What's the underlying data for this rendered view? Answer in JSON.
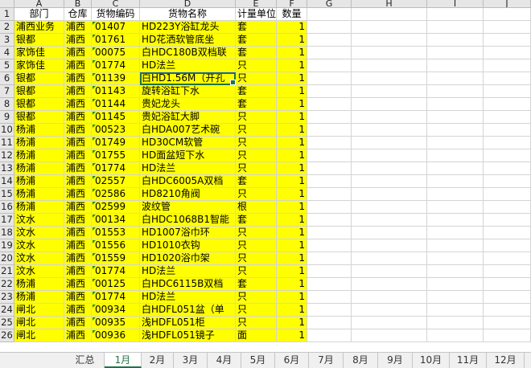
{
  "columns": [
    "A",
    "B",
    "C",
    "D",
    "E",
    "F",
    "G",
    "H",
    "I",
    "J"
  ],
  "header_row": [
    "部门",
    "仓库",
    "货物编码",
    "货物名称",
    "计量单位",
    "数量"
  ],
  "rows": [
    {
      "n": "2",
      "a": "浦西业务",
      "b": "浦西",
      "c": "01407",
      "d": "HD223Y浴缸龙头",
      "e": "套",
      "f": "1"
    },
    {
      "n": "3",
      "a": "银都",
      "b": "浦西",
      "c": "01761",
      "d": "HD花洒软管底坐",
      "e": "套",
      "f": "1"
    },
    {
      "n": "4",
      "a": "家饰佳",
      "b": "浦西",
      "c": "00075",
      "d": "白HDC180B双档联",
      "e": "套",
      "f": "1"
    },
    {
      "n": "5",
      "a": "家饰佳",
      "b": "浦西",
      "c": "01774",
      "d": "HD法兰",
      "e": "只",
      "f": "1"
    },
    {
      "n": "6",
      "a": "银都",
      "b": "浦西",
      "c": "01139",
      "d": "白HD1.56M（开孔",
      "e": "只",
      "f": "1"
    },
    {
      "n": "7",
      "a": "银都",
      "b": "浦西",
      "c": "01143",
      "d": "旋转浴缸下水",
      "e": "套",
      "f": "1"
    },
    {
      "n": "8",
      "a": "银都",
      "b": "浦西",
      "c": "01144",
      "d": "贵妃龙头",
      "e": "套",
      "f": "1"
    },
    {
      "n": "9",
      "a": "银都",
      "b": "浦西",
      "c": "01145",
      "d": "贵妃浴缸大脚",
      "e": "只",
      "f": "1"
    },
    {
      "n": "10",
      "a": "杨浦",
      "b": "浦西",
      "c": "00523",
      "d": "白HDA007艺术碗",
      "e": "只",
      "f": "1"
    },
    {
      "n": "11",
      "a": "杨浦",
      "b": "浦西",
      "c": "01749",
      "d": "HD30CM软管",
      "e": "只",
      "f": "1"
    },
    {
      "n": "12",
      "a": "杨浦",
      "b": "浦西",
      "c": "01755",
      "d": "HD面盆短下水",
      "e": "只",
      "f": "1"
    },
    {
      "n": "13",
      "a": "杨浦",
      "b": "浦西",
      "c": "01774",
      "d": "HD法兰",
      "e": "只",
      "f": "1"
    },
    {
      "n": "14",
      "a": "杨浦",
      "b": "浦西",
      "c": "02557",
      "d": "白HDC6005A双档",
      "e": "套",
      "f": "1"
    },
    {
      "n": "15",
      "a": "杨浦",
      "b": "浦西",
      "c": "02586",
      "d": "HD8210角阀",
      "e": "只",
      "f": "1"
    },
    {
      "n": "16",
      "a": "杨浦",
      "b": "浦西",
      "c": "02599",
      "d": "波纹管",
      "e": "根",
      "f": "1"
    },
    {
      "n": "17",
      "a": "汶水",
      "b": "浦西",
      "c": "00134",
      "d": "白HDC1068B1智能",
      "e": "套",
      "f": "1"
    },
    {
      "n": "18",
      "a": "汶水",
      "b": "浦西",
      "c": "01553",
      "d": "HD1007浴巾环",
      "e": "只",
      "f": "1"
    },
    {
      "n": "19",
      "a": "汶水",
      "b": "浦西",
      "c": "01556",
      "d": "HD1010衣钩",
      "e": "只",
      "f": "1"
    },
    {
      "n": "20",
      "a": "汶水",
      "b": "浦西",
      "c": "01559",
      "d": "HD1020浴巾架",
      "e": "只",
      "f": "1"
    },
    {
      "n": "21",
      "a": "汶水",
      "b": "浦西",
      "c": "01774",
      "d": "HD法兰",
      "e": "只",
      "f": "1"
    },
    {
      "n": "22",
      "a": "杨浦",
      "b": "浦西",
      "c": "00125",
      "d": "白HDC6115B双档",
      "e": "套",
      "f": "1"
    },
    {
      "n": "23",
      "a": "杨浦",
      "b": "浦西",
      "c": "01774",
      "d": "HD法兰",
      "e": "只",
      "f": "1"
    },
    {
      "n": "24",
      "a": "闸北",
      "b": "浦西",
      "c": "00934",
      "d": "白HDFL051盆（单",
      "e": "只",
      "f": "1"
    },
    {
      "n": "25",
      "a": "闸北",
      "b": "浦西",
      "c": "00935",
      "d": "浅HDFL051柜",
      "e": "只",
      "f": "1"
    },
    {
      "n": "26",
      "a": "闸北",
      "b": "浦西",
      "c": "00936",
      "d": "浅HDFL051镜子",
      "e": "面",
      "f": "1"
    }
  ],
  "selected_cell": "D6",
  "sheet_tabs": [
    "汇总",
    "1月",
    "2月",
    "3月",
    "4月",
    "5月",
    "6月",
    "7月",
    "8月",
    "9月",
    "10月",
    "11月",
    "12月"
  ],
  "active_tab": "1月",
  "colors": {
    "fill": "#ffff00",
    "accent": "#217346",
    "header_bg": "#e6e6e6",
    "triangle": "#1e8a2e"
  }
}
